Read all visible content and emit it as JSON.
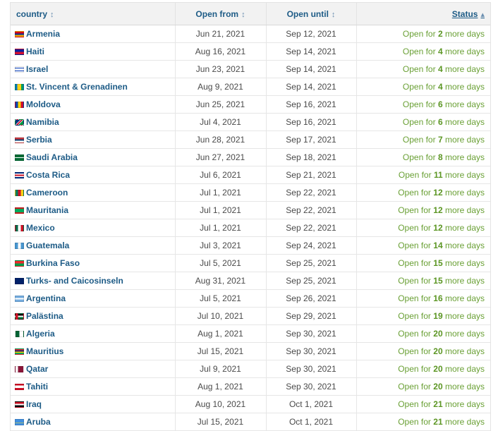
{
  "headers": {
    "country": "country",
    "open_from": "Open from",
    "open_until": "Open until",
    "status": "Status"
  },
  "icons": {
    "sort": "sort-icon",
    "sort_up": "sort-ascending-icon"
  },
  "colors": {
    "link": "#1d5b86",
    "status_green": "#6aa035",
    "header_bg": "#f2f2f2"
  },
  "status_template": {
    "prefix": "Open for",
    "suffix": "more days"
  },
  "rows": [
    {
      "country": "Armenia",
      "flag": "linear-gradient(#d90012 33%, #0033a0 33% 66%, #f2a800 66%)",
      "from": "Jun 21, 2021",
      "until": "Sep 12, 2021",
      "days": "2"
    },
    {
      "country": "Haiti",
      "flag": "linear-gradient(#00209f 50%, #d21034 50%)",
      "from": "Aug 16, 2021",
      "until": "Sep 14, 2021",
      "days": "4"
    },
    {
      "country": "Israel",
      "flag": "linear-gradient(#fff 15%, #0038b8 15% 28%, #fff 28% 72%, #0038b8 72% 85%, #fff 85%)",
      "from": "Jun 23, 2021",
      "until": "Sep 14, 2021",
      "days": "4"
    },
    {
      "country": "St. Vincent & Grenadinen",
      "flag": "linear-gradient(90deg, #0072c6 25%, #fcd116 25% 75%, #009e60 75%)",
      "from": "Aug 9, 2021",
      "until": "Sep 14, 2021",
      "days": "4"
    },
    {
      "country": "Moldova",
      "flag": "linear-gradient(90deg, #0046ae 33%, #ffd200 33% 66%, #cc092f 66%)",
      "from": "Jun 25, 2021",
      "until": "Sep 16, 2021",
      "days": "6"
    },
    {
      "country": "Namibia",
      "flag": "linear-gradient(135deg, #003580 38%, #fff 38% 42%, #d21034 42% 58%, #fff 58% 62%, #009543 62%)",
      "from": "Jul 4, 2021",
      "until": "Sep 16, 2021",
      "days": "6"
    },
    {
      "country": "Serbia",
      "flag": "linear-gradient(#c6363c 33%, #0c4076 33% 66%, #fff 66%)",
      "from": "Jun 28, 2021",
      "until": "Sep 17, 2021",
      "days": "7"
    },
    {
      "country": "Saudi Arabia",
      "flag": "linear-gradient(#006c35 40%, #fff 40% 60%, #006c35 60%)",
      "from": "Jun 27, 2021",
      "until": "Sep 18, 2021",
      "days": "8"
    },
    {
      "country": "Costa Rica",
      "flag": "linear-gradient(#002b7f 17%, #fff 17% 33%, #ce1126 33% 67%, #fff 67% 83%, #002b7f 83%)",
      "from": "Jul 6, 2021",
      "until": "Sep 21, 2021",
      "days": "11"
    },
    {
      "country": "Cameroon",
      "flag": "linear-gradient(90deg, #007a5e 33%, #ce1126 33% 66%, #fcd116 66%)",
      "from": "Jul 1, 2021",
      "until": "Sep 22, 2021",
      "days": "12"
    },
    {
      "country": "Mauritania",
      "flag": "linear-gradient(#d01c1f 15%, #00a95c 15% 85%, #d01c1f 85%)",
      "from": "Jul 1, 2021",
      "until": "Sep 22, 2021",
      "days": "12"
    },
    {
      "country": "Mexico",
      "flag": "linear-gradient(90deg, #006847 33%, #fff 33% 66%, #ce1126 66%)",
      "from": "Jul 1, 2021",
      "until": "Sep 22, 2021",
      "days": "12"
    },
    {
      "country": "Guatemala",
      "flag": "linear-gradient(90deg, #4997d0 33%, #fff 33% 66%, #4997d0 66%)",
      "from": "Jul 3, 2021",
      "until": "Sep 24, 2021",
      "days": "14"
    },
    {
      "country": "Burkina Faso",
      "flag": "linear-gradient(#ef2b2d 50%, #009e49 50%)",
      "from": "Jul 5, 2021",
      "until": "Sep 25, 2021",
      "days": "15"
    },
    {
      "country": "Turks- and Caicosinseln",
      "flag": "linear-gradient(90deg, #012169 60%, #012169 60%)",
      "from": "Aug 31, 2021",
      "until": "Sep 25, 2021",
      "days": "15"
    },
    {
      "country": "Argentina",
      "flag": "linear-gradient(#74acdf 33%, #fff 33% 66%, #74acdf 66%)",
      "from": "Jul 5, 2021",
      "until": "Sep 26, 2021",
      "days": "16"
    },
    {
      "country": "Palästina",
      "flag": "linear-gradient(90deg, #ce1126 30%, transparent 30%), linear-gradient(#000 33%, #fff 33% 66%, #007a3d 66%)",
      "from": "Jul 10, 2021",
      "until": "Sep 29, 2021",
      "days": "19"
    },
    {
      "country": "Algeria",
      "flag": "linear-gradient(90deg, #006233 50%, #fff 50%)",
      "from": "Aug 1, 2021",
      "until": "Sep 30, 2021",
      "days": "20"
    },
    {
      "country": "Mauritius",
      "flag": "linear-gradient(#ea2839 25%, #1a206d 25% 50%, #ffd500 50% 75%, #00a551 75%)",
      "from": "Jul 15, 2021",
      "until": "Sep 30, 2021",
      "days": "20"
    },
    {
      "country": "Qatar",
      "flag": "linear-gradient(90deg, #fff 30%, #8a1538 30%)",
      "from": "Jul 9, 2021",
      "until": "Sep 30, 2021",
      "days": "20"
    },
    {
      "country": "Tahiti",
      "flag": "linear-gradient(#ce1126 25%, #fff 25% 75%, #ce1126 75%)",
      "from": "Aug 1, 2021",
      "until": "Sep 30, 2021",
      "days": "20"
    },
    {
      "country": "Iraq",
      "flag": "linear-gradient(#ce1126 33%, #fff 33% 66%, #000 66%)",
      "from": "Aug 10, 2021",
      "until": "Oct 1, 2021",
      "days": "21"
    },
    {
      "country": "Aruba",
      "flag": "linear-gradient(#418fde 62%, #fbe122 62% 72%, #418fde 72%)",
      "from": "Jul 15, 2021",
      "until": "Oct 1, 2021",
      "days": "21"
    }
  ]
}
